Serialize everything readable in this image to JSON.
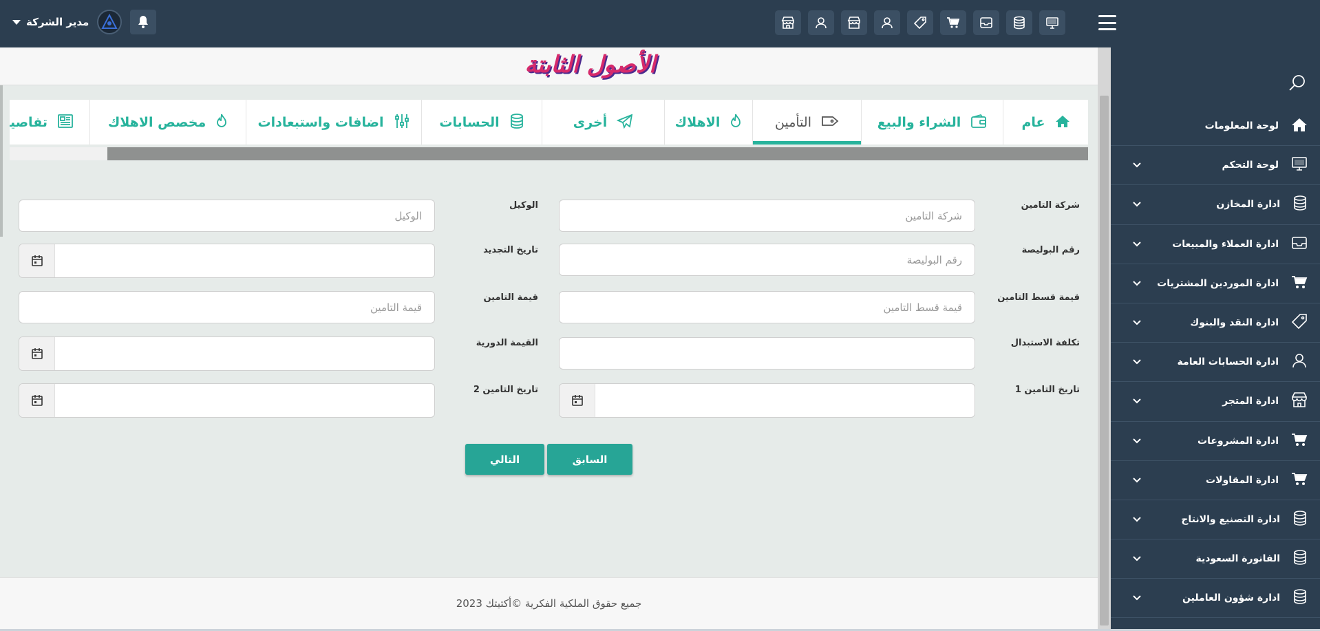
{
  "header": {
    "user_label": "مدير الشركة",
    "top_icons": [
      "store-icon",
      "user-icon",
      "store-icon",
      "user-icon",
      "tag-icon",
      "cart-icon",
      "inbox-icon",
      "database-icon",
      "monitor-icon"
    ]
  },
  "sidebar": {
    "items": [
      {
        "label": "لوحة المعلومات",
        "icon": "home-icon",
        "has_chevron": false
      },
      {
        "label": "لوحة التحكم",
        "icon": "monitor-icon",
        "has_chevron": true
      },
      {
        "label": "ادارة المخازن",
        "icon": "database-icon",
        "has_chevron": true
      },
      {
        "label": "ادارة العملاء والمبيعات",
        "icon": "inbox-icon",
        "has_chevron": true
      },
      {
        "label": "ادارة الموردين المشتريات",
        "icon": "cart-icon",
        "has_chevron": true
      },
      {
        "label": "ادارة النقد والبنوك",
        "icon": "tag-icon",
        "has_chevron": true
      },
      {
        "label": "ادارة الحسابات العامة",
        "icon": "user-icon",
        "has_chevron": true
      },
      {
        "label": "ادارة المتجر",
        "icon": "store-icon",
        "has_chevron": true
      },
      {
        "label": "ادارة المشروعات",
        "icon": "cart-icon",
        "has_chevron": true
      },
      {
        "label": "ادارة المقاولات",
        "icon": "cart-icon",
        "has_chevron": true
      },
      {
        "label": "ادارة التصنيع والانتاج",
        "icon": "database-icon",
        "has_chevron": true
      },
      {
        "label": "الفاتورة السعودية",
        "icon": "database-icon",
        "has_chevron": true
      },
      {
        "label": "ادارة شؤون العاملين",
        "icon": "database-icon",
        "has_chevron": true
      }
    ]
  },
  "page": {
    "title": "الأصول الثابتة"
  },
  "tabs": [
    {
      "label": "عام",
      "icon": "home-icon",
      "active": false
    },
    {
      "label": "الشراء والبيع",
      "icon": "wallet-icon",
      "active": false
    },
    {
      "label": "التأمين",
      "icon": "tag-icon",
      "active": true
    },
    {
      "label": "الاهلاك",
      "icon": "fire-icon",
      "active": false
    },
    {
      "label": "أخرى",
      "icon": "send-icon",
      "active": false
    },
    {
      "label": "الحسابات",
      "icon": "database-icon",
      "active": false
    },
    {
      "label": "اضافات واستبعادات",
      "icon": "sliders-icon",
      "active": false
    },
    {
      "label": "مخصص الاهلاك",
      "icon": "fire-icon",
      "active": false
    },
    {
      "label": "تفاصيل",
      "icon": "newspaper-icon",
      "active": false
    }
  ],
  "form": {
    "insurance_company": {
      "label": "شركة التامين",
      "placeholder": "شركة التامين",
      "value": ""
    },
    "agent": {
      "label": "الوكيل",
      "placeholder": "الوكيل",
      "value": ""
    },
    "policy_number": {
      "label": "رقم البوليصة",
      "placeholder": "رقم البوليصة",
      "value": ""
    },
    "renewal_date": {
      "label": "تاريخ التجديد",
      "value": ""
    },
    "premium_value": {
      "label": "قيمة قسط التامين",
      "placeholder": "قيمة قسط التامين",
      "value": ""
    },
    "insurance_value": {
      "label": "قيمة التامين",
      "placeholder": "قيمة التامين",
      "value": ""
    },
    "replacement_cost": {
      "label": "تكلفة الاستبدال",
      "value": ""
    },
    "periodic_value": {
      "label": "القيمة الدورية",
      "value": ""
    },
    "insurance_date_1": {
      "label": "تاريخ التامين 1",
      "value": ""
    },
    "insurance_date_2": {
      "label": "تاريخ التامين 2",
      "value": ""
    }
  },
  "buttons": {
    "previous": "السابق",
    "next": "التالي"
  },
  "footer": {
    "text": "جميع حقوق الملكية الفكرية ©أكتيتك 2023"
  },
  "colors": {
    "header_bg": "#2c3e50",
    "accent": "#27b39c",
    "title_pink": "#d62a6b",
    "content_bg": "#e6ebe9"
  }
}
